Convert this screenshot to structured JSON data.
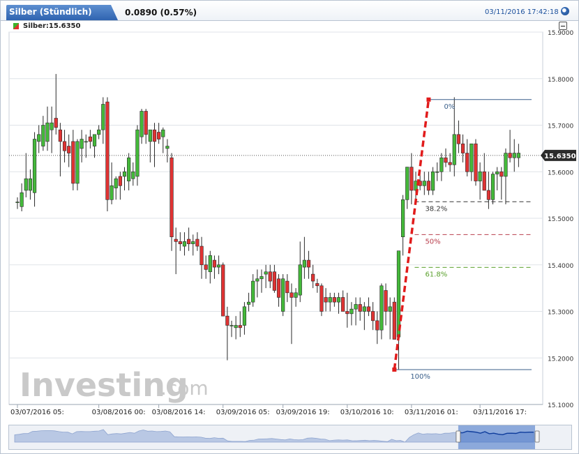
{
  "header": {
    "title": "Silber (Stündlich)",
    "change": "0.0890 (0.57%)",
    "timestamp": "03/11/2016 17:42:18"
  },
  "legend": {
    "label": "Silber:15.6350",
    "swatch_colors": [
      "#3cb22c",
      "#e03030"
    ]
  },
  "watermark": {
    "brand": "Investing",
    "suffix": ".com"
  },
  "colors": {
    "up": "#44b93a",
    "down": "#e03333",
    "fib_line": "#e11b1b",
    "fib_0": "#3a5f8a",
    "fib_382": "#333333",
    "fib_50": "#b83c4a",
    "fib_618": "#5aa02c",
    "price_tag_bg": "#2b2b2b",
    "grid": "#dfe3e8"
  },
  "chart_data": {
    "type": "candlestick",
    "title": "",
    "xlabel": "",
    "ylabel": "",
    "ylim": [
      15.1,
      15.9
    ],
    "y_ticks": [
      "15.1000",
      "15.2000",
      "15.3000",
      "15.4000",
      "15.5000",
      "15.6000",
      "15.7000",
      "15.8000",
      "15.9000"
    ],
    "x_ticks": [
      {
        "label": "03/07/2016 05:",
        "index": 0
      },
      {
        "label": "03/08/2016 00:",
        "index": 19
      },
      {
        "label": "03/08/2016 14:",
        "index": 33
      },
      {
        "label": "03/09/2016 05:",
        "index": 48
      },
      {
        "label": "03/09/2016 19:",
        "index": 62
      },
      {
        "label": "03/10/2016 10:",
        "index": 77
      },
      {
        "label": "03/11/2016 01:",
        "index": 92
      },
      {
        "label": "03/11/2016 17:",
        "index": 108
      }
    ],
    "last_price": "15.6350",
    "last_price_value": 15.635,
    "candles": [
      {
        "o": 15.535,
        "h": 15.545,
        "l": 15.52,
        "c": 15.535
      },
      {
        "o": 15.525,
        "h": 15.575,
        "l": 15.515,
        "c": 15.555
      },
      {
        "o": 15.56,
        "h": 15.64,
        "l": 15.545,
        "c": 15.585
      },
      {
        "o": 15.56,
        "h": 15.605,
        "l": 15.54,
        "c": 15.585
      },
      {
        "o": 15.555,
        "h": 15.685,
        "l": 15.525,
        "c": 15.67
      },
      {
        "o": 15.665,
        "h": 15.7,
        "l": 15.64,
        "c": 15.68
      },
      {
        "o": 15.655,
        "h": 15.72,
        "l": 15.645,
        "c": 15.7
      },
      {
        "o": 15.665,
        "h": 15.74,
        "l": 15.645,
        "c": 15.705
      },
      {
        "o": 15.69,
        "h": 15.74,
        "l": 15.64,
        "c": 15.705
      },
      {
        "o": 15.715,
        "h": 15.81,
        "l": 15.68,
        "c": 15.695
      },
      {
        "o": 15.69,
        "h": 15.705,
        "l": 15.59,
        "c": 15.665
      },
      {
        "o": 15.665,
        "h": 15.69,
        "l": 15.62,
        "c": 15.645
      },
      {
        "o": 15.655,
        "h": 15.68,
        "l": 15.61,
        "c": 15.64
      },
      {
        "o": 15.665,
        "h": 15.69,
        "l": 15.56,
        "c": 15.575
      },
      {
        "o": 15.575,
        "h": 15.67,
        "l": 15.56,
        "c": 15.665
      },
      {
        "o": 15.65,
        "h": 15.69,
        "l": 15.62,
        "c": 15.67
      },
      {
        "o": 15.665,
        "h": 15.68,
        "l": 15.63,
        "c": 15.665
      },
      {
        "o": 15.675,
        "h": 15.69,
        "l": 15.65,
        "c": 15.665
      },
      {
        "o": 15.655,
        "h": 15.68,
        "l": 15.63,
        "c": 15.68
      },
      {
        "o": 15.68,
        "h": 15.7,
        "l": 15.67,
        "c": 15.69
      },
      {
        "o": 15.69,
        "h": 15.76,
        "l": 15.66,
        "c": 15.745
      },
      {
        "o": 15.75,
        "h": 15.76,
        "l": 15.515,
        "c": 15.54
      },
      {
        "o": 15.54,
        "h": 15.62,
        "l": 15.53,
        "c": 15.57
      },
      {
        "o": 15.565,
        "h": 15.59,
        "l": 15.54,
        "c": 15.585
      },
      {
        "o": 15.59,
        "h": 15.6,
        "l": 15.54,
        "c": 15.57
      },
      {
        "o": 15.59,
        "h": 15.61,
        "l": 15.56,
        "c": 15.6
      },
      {
        "o": 15.58,
        "h": 15.64,
        "l": 15.56,
        "c": 15.63
      },
      {
        "o": 15.585,
        "h": 15.62,
        "l": 15.57,
        "c": 15.6
      },
      {
        "o": 15.59,
        "h": 15.7,
        "l": 15.57,
        "c": 15.69
      },
      {
        "o": 15.675,
        "h": 15.735,
        "l": 15.66,
        "c": 15.73
      },
      {
        "o": 15.73,
        "h": 15.735,
        "l": 15.66,
        "c": 15.68
      },
      {
        "o": 15.665,
        "h": 15.69,
        "l": 15.62,
        "c": 15.69
      },
      {
        "o": 15.69,
        "h": 15.705,
        "l": 15.61,
        "c": 15.665
      },
      {
        "o": 15.685,
        "h": 15.705,
        "l": 15.66,
        "c": 15.67
      },
      {
        "o": 15.675,
        "h": 15.695,
        "l": 15.64,
        "c": 15.69
      },
      {
        "o": 15.65,
        "h": 15.67,
        "l": 15.62,
        "c": 15.655
      },
      {
        "o": 15.63,
        "h": 15.64,
        "l": 15.43,
        "c": 15.46
      },
      {
        "o": 15.455,
        "h": 15.48,
        "l": 15.38,
        "c": 15.45
      },
      {
        "o": 15.45,
        "h": 15.47,
        "l": 15.43,
        "c": 15.445
      },
      {
        "o": 15.44,
        "h": 15.47,
        "l": 15.42,
        "c": 15.45
      },
      {
        "o": 15.455,
        "h": 15.48,
        "l": 15.43,
        "c": 15.445
      },
      {
        "o": 15.445,
        "h": 15.465,
        "l": 15.42,
        "c": 15.45
      },
      {
        "o": 15.455,
        "h": 15.47,
        "l": 15.43,
        "c": 15.44
      },
      {
        "o": 15.44,
        "h": 15.46,
        "l": 15.37,
        "c": 15.4
      },
      {
        "o": 15.4,
        "h": 15.42,
        "l": 15.37,
        "c": 15.39
      },
      {
        "o": 15.385,
        "h": 15.43,
        "l": 15.36,
        "c": 15.42
      },
      {
        "o": 15.41,
        "h": 15.42,
        "l": 15.37,
        "c": 15.395
      },
      {
        "o": 15.395,
        "h": 15.42,
        "l": 15.38,
        "c": 15.4
      },
      {
        "o": 15.4,
        "h": 15.405,
        "l": 15.29,
        "c": 15.29
      },
      {
        "o": 15.29,
        "h": 15.31,
        "l": 15.195,
        "c": 15.27
      },
      {
        "o": 15.27,
        "h": 15.28,
        "l": 15.245,
        "c": 15.27
      },
      {
        "o": 15.265,
        "h": 15.29,
        "l": 15.24,
        "c": 15.27
      },
      {
        "o": 15.27,
        "h": 15.3,
        "l": 15.245,
        "c": 15.265
      },
      {
        "o": 15.27,
        "h": 15.32,
        "l": 15.25,
        "c": 15.31
      },
      {
        "o": 15.315,
        "h": 15.34,
        "l": 15.3,
        "c": 15.32
      },
      {
        "o": 15.32,
        "h": 15.38,
        "l": 15.31,
        "c": 15.365
      },
      {
        "o": 15.365,
        "h": 15.39,
        "l": 15.33,
        "c": 15.37
      },
      {
        "o": 15.37,
        "h": 15.39,
        "l": 15.34,
        "c": 15.375
      },
      {
        "o": 15.38,
        "h": 15.4,
        "l": 15.35,
        "c": 15.385
      },
      {
        "o": 15.385,
        "h": 15.4,
        "l": 15.35,
        "c": 15.365
      },
      {
        "o": 15.385,
        "h": 15.4,
        "l": 15.34,
        "c": 15.345
      },
      {
        "o": 15.37,
        "h": 15.38,
        "l": 15.31,
        "c": 15.33
      },
      {
        "o": 15.3,
        "h": 15.38,
        "l": 15.29,
        "c": 15.37
      },
      {
        "o": 15.365,
        "h": 15.38,
        "l": 15.32,
        "c": 15.34
      },
      {
        "o": 15.34,
        "h": 15.36,
        "l": 15.23,
        "c": 15.33
      },
      {
        "o": 15.33,
        "h": 15.35,
        "l": 15.31,
        "c": 15.34
      },
      {
        "o": 15.335,
        "h": 15.45,
        "l": 15.32,
        "c": 15.4
      },
      {
        "o": 15.395,
        "h": 15.46,
        "l": 15.37,
        "c": 15.41
      },
      {
        "o": 15.41,
        "h": 15.43,
        "l": 15.37,
        "c": 15.395
      },
      {
        "o": 15.38,
        "h": 15.4,
        "l": 15.35,
        "c": 15.365
      },
      {
        "o": 15.36,
        "h": 15.37,
        "l": 15.34,
        "c": 15.355
      },
      {
        "o": 15.355,
        "h": 15.36,
        "l": 15.29,
        "c": 15.3
      },
      {
        "o": 15.33,
        "h": 15.35,
        "l": 15.3,
        "c": 15.32
      },
      {
        "o": 15.32,
        "h": 15.34,
        "l": 15.3,
        "c": 15.33
      },
      {
        "o": 15.33,
        "h": 15.34,
        "l": 15.31,
        "c": 15.32
      },
      {
        "o": 15.32,
        "h": 15.34,
        "l": 15.295,
        "c": 15.33
      },
      {
        "o": 15.33,
        "h": 15.345,
        "l": 15.31,
        "c": 15.3
      },
      {
        "o": 15.3,
        "h": 15.34,
        "l": 15.265,
        "c": 15.295
      },
      {
        "o": 15.295,
        "h": 15.32,
        "l": 15.27,
        "c": 15.305
      },
      {
        "o": 15.305,
        "h": 15.33,
        "l": 15.27,
        "c": 15.315
      },
      {
        "o": 15.315,
        "h": 15.33,
        "l": 15.28,
        "c": 15.3
      },
      {
        "o": 15.3,
        "h": 15.32,
        "l": 15.26,
        "c": 15.31
      },
      {
        "o": 15.31,
        "h": 15.33,
        "l": 15.29,
        "c": 15.3
      },
      {
        "o": 15.3,
        "h": 15.32,
        "l": 15.26,
        "c": 15.28
      },
      {
        "o": 15.28,
        "h": 15.3,
        "l": 15.23,
        "c": 15.26
      },
      {
        "o": 15.26,
        "h": 15.36,
        "l": 15.24,
        "c": 15.355
      },
      {
        "o": 15.345,
        "h": 15.36,
        "l": 15.27,
        "c": 15.3
      },
      {
        "o": 15.3,
        "h": 15.33,
        "l": 15.24,
        "c": 15.31
      },
      {
        "o": 15.32,
        "h": 15.33,
        "l": 15.24,
        "c": 15.24
      },
      {
        "o": 15.245,
        "h": 15.43,
        "l": 15.175,
        "c": 15.43
      },
      {
        "o": 15.46,
        "h": 15.55,
        "l": 15.42,
        "c": 15.54
      },
      {
        "o": 15.54,
        "h": 15.61,
        "l": 15.52,
        "c": 15.61
      },
      {
        "o": 15.61,
        "h": 15.64,
        "l": 15.53,
        "c": 15.56
      },
      {
        "o": 15.56,
        "h": 15.6,
        "l": 15.54,
        "c": 15.58
      },
      {
        "o": 15.58,
        "h": 15.6,
        "l": 15.56,
        "c": 15.57
      },
      {
        "o": 15.57,
        "h": 15.6,
        "l": 15.55,
        "c": 15.58
      },
      {
        "o": 15.58,
        "h": 15.6,
        "l": 15.55,
        "c": 15.56
      },
      {
        "o": 15.56,
        "h": 15.61,
        "l": 15.55,
        "c": 15.6
      },
      {
        "o": 15.6,
        "h": 15.62,
        "l": 15.58,
        "c": 15.6
      },
      {
        "o": 15.6,
        "h": 15.64,
        "l": 15.58,
        "c": 15.63
      },
      {
        "o": 15.63,
        "h": 15.65,
        "l": 15.61,
        "c": 15.62
      },
      {
        "o": 15.62,
        "h": 15.64,
        "l": 15.6,
        "c": 15.615
      },
      {
        "o": 15.615,
        "h": 15.76,
        "l": 15.59,
        "c": 15.68
      },
      {
        "o": 15.68,
        "h": 15.71,
        "l": 15.64,
        "c": 15.66
      },
      {
        "o": 15.66,
        "h": 15.68,
        "l": 15.62,
        "c": 15.64
      },
      {
        "o": 15.64,
        "h": 15.67,
        "l": 15.59,
        "c": 15.6
      },
      {
        "o": 15.6,
        "h": 15.66,
        "l": 15.58,
        "c": 15.66
      },
      {
        "o": 15.66,
        "h": 15.67,
        "l": 15.57,
        "c": 15.58
      },
      {
        "o": 15.58,
        "h": 15.62,
        "l": 15.54,
        "c": 15.6
      },
      {
        "o": 15.6,
        "h": 15.64,
        "l": 15.57,
        "c": 15.56
      },
      {
        "o": 15.56,
        "h": 15.6,
        "l": 15.52,
        "c": 15.54
      },
      {
        "o": 15.54,
        "h": 15.6,
        "l": 15.53,
        "c": 15.595
      },
      {
        "o": 15.595,
        "h": 15.61,
        "l": 15.56,
        "c": 15.6
      },
      {
        "o": 15.6,
        "h": 15.61,
        "l": 15.54,
        "c": 15.59
      },
      {
        "o": 15.59,
        "h": 15.65,
        "l": 15.53,
        "c": 15.64
      },
      {
        "o": 15.64,
        "h": 15.69,
        "l": 15.62,
        "c": 15.63
      },
      {
        "o": 15.63,
        "h": 15.67,
        "l": 15.6,
        "c": 15.64
      },
      {
        "o": 15.63,
        "h": 15.66,
        "l": 15.61,
        "c": 15.64
      }
    ],
    "fibonacci": {
      "start": {
        "index": 88,
        "value": 15.175
      },
      "end": {
        "index": 96,
        "value": 15.755
      },
      "levels": [
        {
          "label": "0%",
          "value": 15.755
        },
        {
          "label": "38.2%",
          "value": 15.5355
        },
        {
          "label": "50%",
          "value": 15.465
        },
        {
          "label": "61.8%",
          "value": 15.3945
        },
        {
          "label": "100%",
          "value": 15.175
        }
      ]
    }
  }
}
